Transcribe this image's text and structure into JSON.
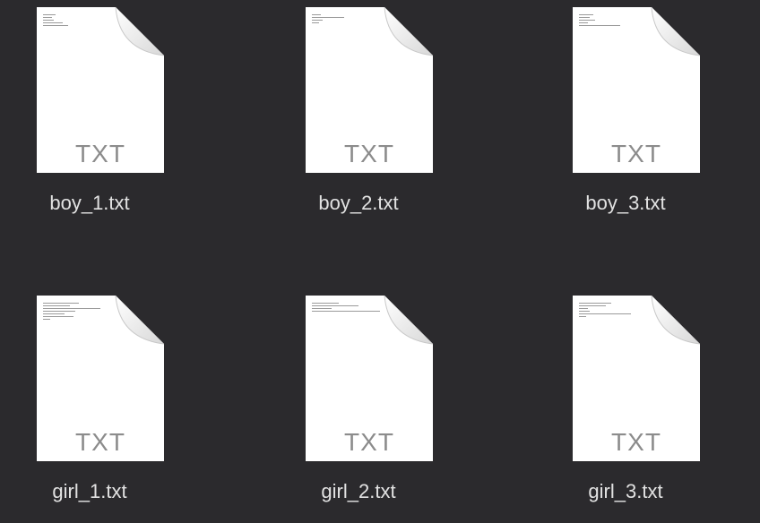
{
  "files": [
    {
      "name": "boy_1.txt",
      "ext_label": "TXT",
      "icon": "text-document-icon"
    },
    {
      "name": "boy_2.txt",
      "ext_label": "TXT",
      "icon": "text-document-icon"
    },
    {
      "name": "boy_3.txt",
      "ext_label": "TXT",
      "icon": "text-document-icon"
    },
    {
      "name": "girl_1.txt",
      "ext_label": "TXT",
      "icon": "text-document-icon"
    },
    {
      "name": "girl_2.txt",
      "ext_label": "TXT",
      "icon": "text-document-icon"
    },
    {
      "name": "girl_3.txt",
      "ext_label": "TXT",
      "icon": "text-document-icon"
    }
  ],
  "colors": {
    "background": "#2b2a2d",
    "filename_text": "#e2e2e2",
    "icon_label": "#8c8c8c"
  }
}
